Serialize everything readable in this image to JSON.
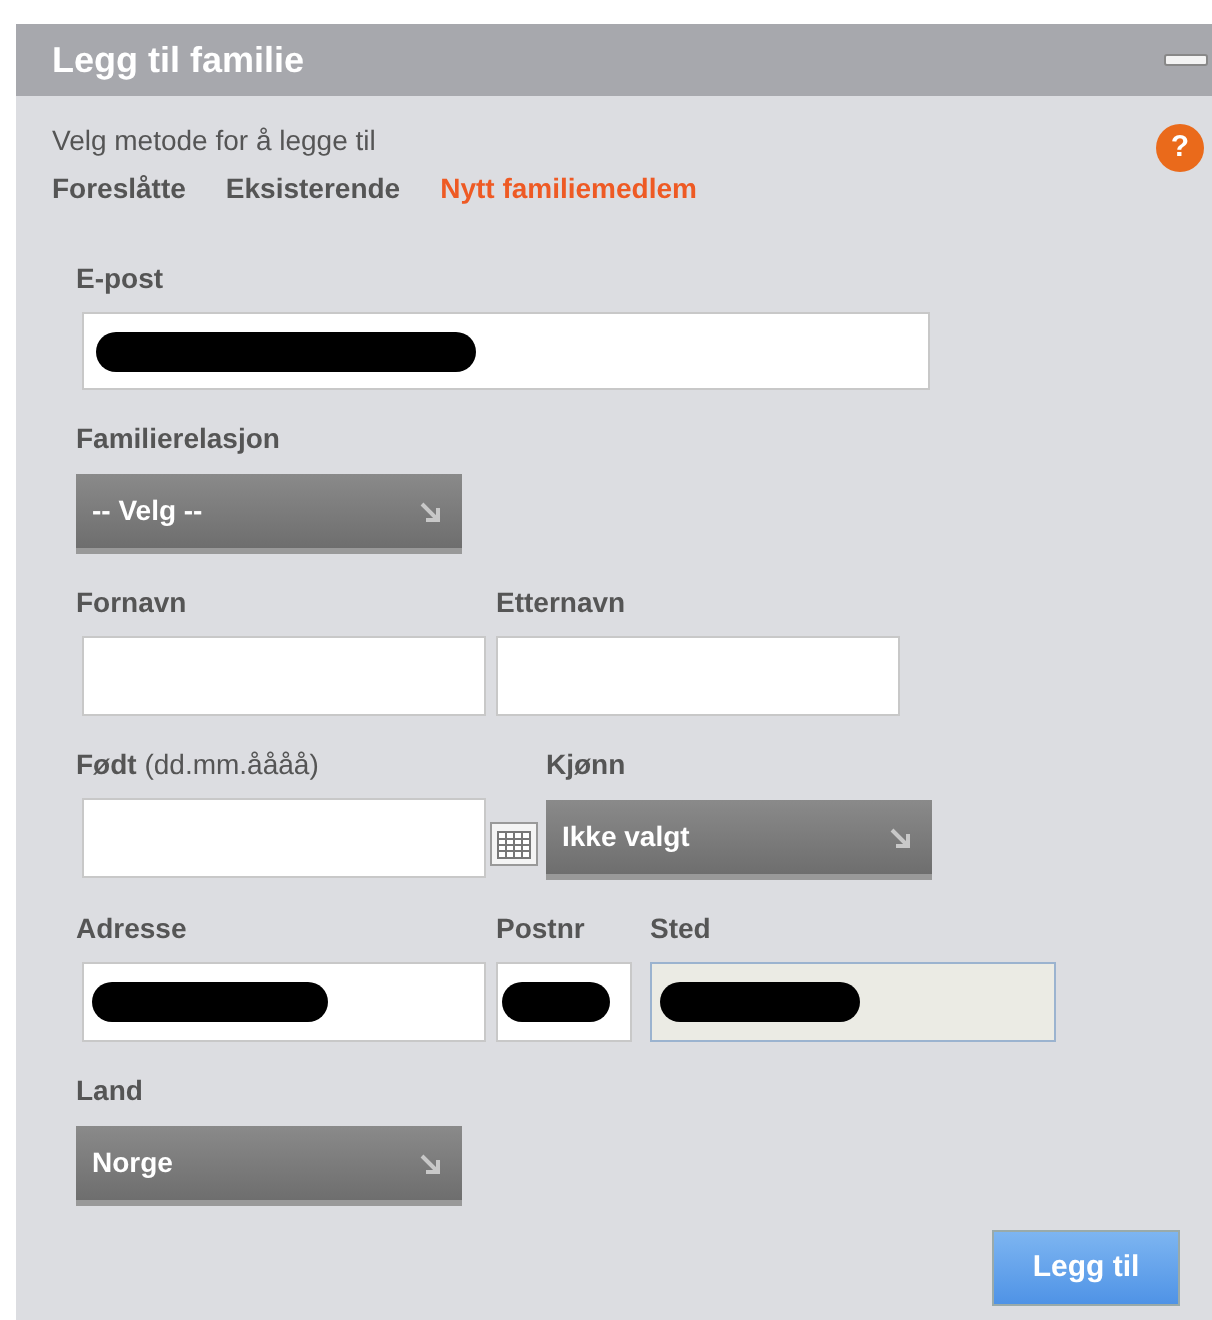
{
  "panel": {
    "title": "Legg til familie"
  },
  "subtitle": "Velg metode for å legge til",
  "help_button": "?",
  "tabs": [
    {
      "label": "Foreslåtte",
      "selected": false
    },
    {
      "label": "Eksisterende",
      "selected": false
    },
    {
      "label": "Nytt familiemedlem",
      "selected": true
    }
  ],
  "email": {
    "label": "E-post",
    "redacted": true
  },
  "relation": {
    "label": "Familierelasjon",
    "value": "-- Velg --"
  },
  "first_name": {
    "label": "Fornavn"
  },
  "last_name": {
    "label": "Etternavn"
  },
  "birth_date": {
    "label": "**Født** (dd.mm.åååå)"
  },
  "gender": {
    "label": "Kjønn",
    "value": "Ikke valgt"
  },
  "address": {
    "label": "Adresse",
    "redacted": true
  },
  "postal_code": {
    "label": "Postnr",
    "redacted": true
  },
  "city": {
    "label": "Sted",
    "redacted": true,
    "disabled": true
  },
  "country": {
    "label": "Land",
    "value": "Norge"
  },
  "submit_button": "Legg til"
}
